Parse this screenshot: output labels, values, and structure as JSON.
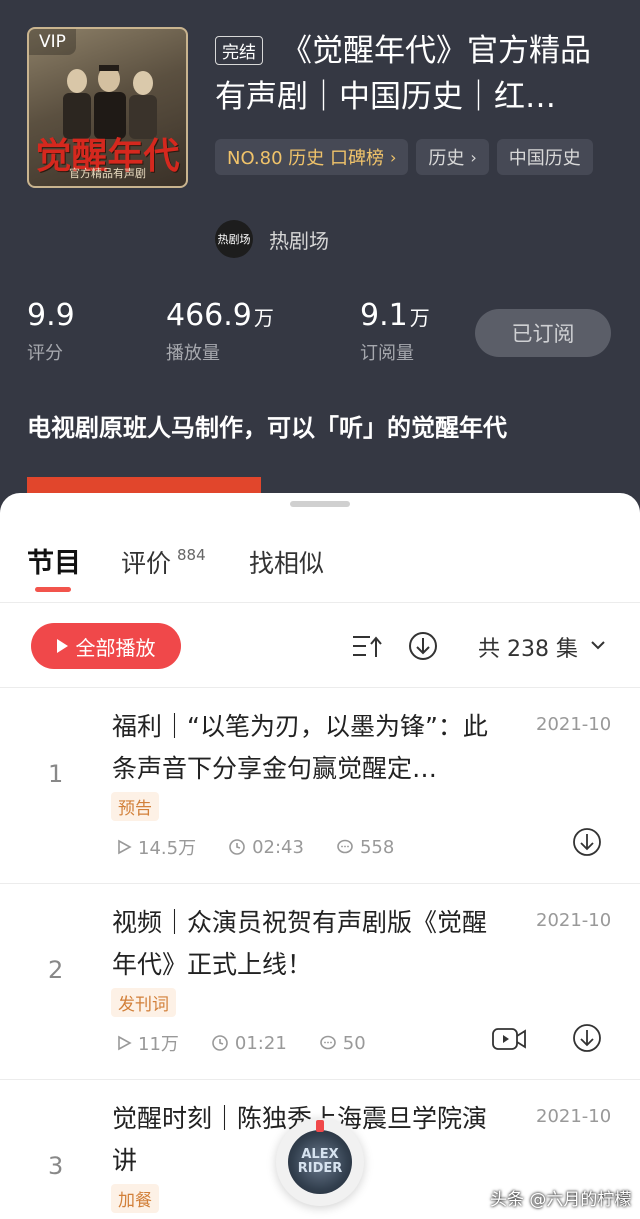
{
  "album": {
    "cover_vip": "VIP",
    "cover_brand": "觉醒年代",
    "cover_sub": "官方精品有声剧",
    "status": "完结",
    "title": "《觉醒年代》官方精品有声剧｜中国历史｜红…",
    "chips": [
      {
        "label": "NO.80 历史 口碑榜"
      },
      {
        "label": "历史"
      },
      {
        "label": "中国历史"
      }
    ],
    "author_avatar": "热剧场",
    "author_name": "热剧场",
    "stats": [
      {
        "num": "9.9",
        "unit": "",
        "label": "评分"
      },
      {
        "num": "466.9",
        "unit": "万",
        "label": "播放量"
      },
      {
        "num": "9.1",
        "unit": "万",
        "label": "订阅量"
      }
    ],
    "subscribe_label": "已订阅",
    "slogan": "电视剧原班人马制作，可以「听」的觉醒年代"
  },
  "tabs": [
    {
      "label": "节目",
      "badge": ""
    },
    {
      "label": "评价",
      "badge": "884"
    },
    {
      "label": "找相似",
      "badge": ""
    }
  ],
  "toolbar": {
    "play_all": "全部播放",
    "count": "共 238 集"
  },
  "episodes": [
    {
      "index": "1",
      "title": "福利｜“以笔为刃，以墨为锋”：此条声音下分享金句赢觉醒定…",
      "date": "2021-10",
      "tag": "预告",
      "plays": "14.5万",
      "duration": "02:43",
      "comments": "558",
      "has_video": false
    },
    {
      "index": "2",
      "title": "视频｜众演员祝贺有声剧版《觉醒年代》正式上线！",
      "date": "2021-10",
      "tag": "发刊词",
      "plays": "11万",
      "duration": "01:21",
      "comments": "50",
      "has_video": true
    },
    {
      "index": "3",
      "title": "觉醒时刻｜陈独秀上海震旦学院演讲",
      "date": "2021-10",
      "tag": "加餐",
      "plays": "",
      "duration": "",
      "comments": "",
      "has_video": false
    }
  ],
  "mini_player": {
    "label": "ALEX RIDER"
  },
  "watermark": "头条 @六月的柠檬",
  "colors": {
    "header_bg": "#353843",
    "accent": "#f0484a",
    "rank_gold": "#f0c36a",
    "tag_orange": "#d2803a"
  }
}
